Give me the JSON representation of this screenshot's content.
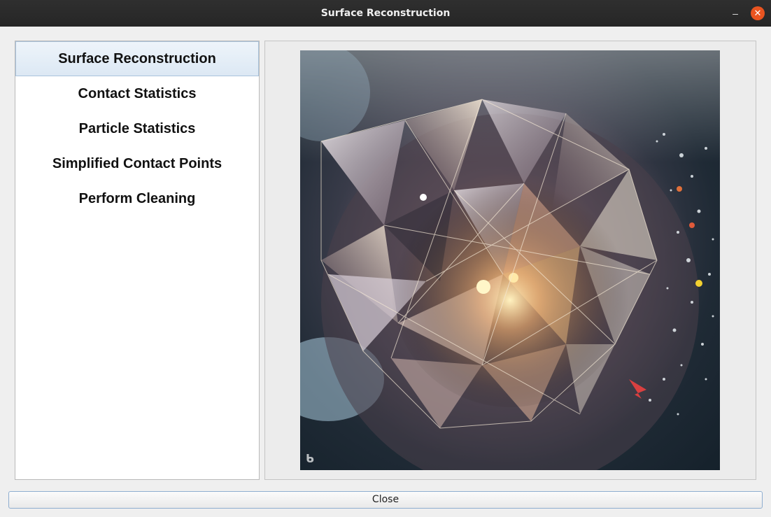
{
  "window": {
    "title": "Surface Reconstruction",
    "minimize_glyph": "–",
    "close_glyph": "✕",
    "accent_color": "#e95420"
  },
  "sidebar": {
    "selected_index": 0,
    "items": [
      {
        "label": "Surface Reconstruction"
      },
      {
        "label": "Contact Statistics"
      },
      {
        "label": "Particle Statistics"
      },
      {
        "label": "Simplified Contact Points"
      },
      {
        "label": "Perform Cleaning"
      }
    ]
  },
  "preview": {
    "image_icon": "crystal-polyhedron-image",
    "watermark_icon": "bing-icon"
  },
  "footer": {
    "close_label": "Close"
  }
}
